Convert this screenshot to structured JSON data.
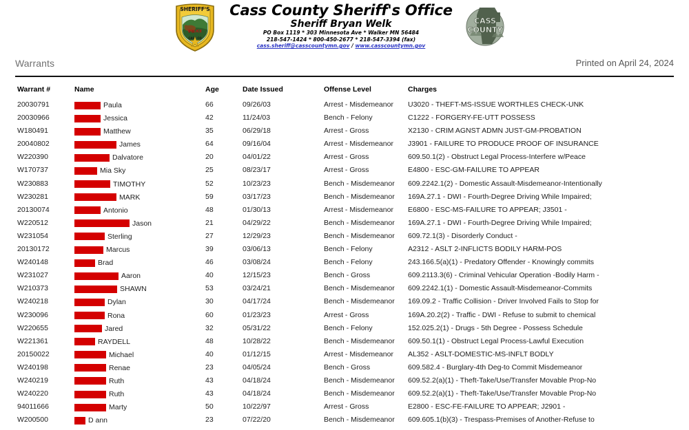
{
  "header": {
    "org_title": "Cass County Sheriff's Office",
    "sheriff_name": "Sheriff Bryan Welk",
    "address_line1": "PO Box 1119 * 303 Minnesota Ave  * Walker MN 56484",
    "address_line2": "218-547-1424 *  800-450-2677 *  218-547-3394 (fax)",
    "email": "cass.sheriff@casscountymn.gov",
    "link_separator": " / ",
    "website": "www.casscountymn.gov",
    "badge_sheriff_alt": "sheriff-badge-logo",
    "badge_sheriff_text": "SHERIFF'S",
    "badge_cass_alt": "cass-county-logo",
    "badge_cass_line1": "CASS",
    "badge_cass_line2": "COUNTY"
  },
  "title_bar": {
    "title": "Warrants",
    "printed_on": "Printed on April 24, 2024"
  },
  "table": {
    "columns": [
      {
        "key": "warrant",
        "label": "Warrant #"
      },
      {
        "key": "name",
        "label": "Name"
      },
      {
        "key": "age",
        "label": "Age"
      },
      {
        "key": "date_issued",
        "label": "Date Issued"
      },
      {
        "key": "offense_level",
        "label": "Offense Level"
      },
      {
        "key": "charges",
        "label": "Charges"
      }
    ],
    "redaction_color": "#d40000",
    "rows": [
      {
        "warrant": "20030791",
        "redact_width": 38,
        "name": "Paula",
        "age": "66",
        "date_issued": "09/26/03",
        "offense_level": "Arrest - Misdemeanor",
        "charges": "U3020 - THEFT-MS-ISSUE WORTHLES CHECK-UNK"
      },
      {
        "warrant": "20030966",
        "redact_width": 38,
        "name": "Jessica",
        "age": "42",
        "date_issued": "11/24/03",
        "offense_level": "Bench - Felony",
        "charges": "C1222 - FORGERY-FE-UTT POSSESS"
      },
      {
        "warrant": "W180491",
        "redact_width": 38,
        "name": "Matthew",
        "age": "35",
        "date_issued": "06/29/18",
        "offense_level": "Arrest - Gross",
        "charges": "X2130 - CRIM AGNST ADMN JUST-GM-PROBATION"
      },
      {
        "warrant": "20040802",
        "redact_width": 61,
        "name": "James",
        "age": "64",
        "date_issued": "09/16/04",
        "offense_level": "Arrest - Misdemeanor",
        "charges": "J3901 - FAILURE TO PRODUCE PROOF OF INSURANCE"
      },
      {
        "warrant": "W220390",
        "redact_width": 51,
        "name": "Dalvatore",
        "age": "20",
        "date_issued": "04/01/22",
        "offense_level": "Arrest - Gross",
        "charges": "609.50.1(2) - Obstruct Legal Process-Interfere w/Peace"
      },
      {
        "warrant": "W170737",
        "redact_width": 33,
        "name": "Mia Sky",
        "age": "25",
        "date_issued": "08/23/17",
        "offense_level": "Arrest - Gross",
        "charges": "E4800 - ESC-GM-FAILURE TO APPEAR"
      },
      {
        "warrant": "W230883",
        "redact_width": 52,
        "name": "TIMOTHY",
        "age": "52",
        "date_issued": "10/23/23",
        "offense_level": "Bench - Misdemeanor",
        "charges": "609.2242.1(2) - Domestic Assault-Misdemeanor-Intentionally"
      },
      {
        "warrant": "W230281",
        "redact_width": 61,
        "name": "MARK",
        "age": "59",
        "date_issued": "03/17/23",
        "offense_level": "Bench - Misdemeanor",
        "charges": "169A.27.1 - DWI - Fourth-Degree Driving While Impaired;"
      },
      {
        "warrant": "20130074",
        "redact_width": 38,
        "name": "Antonio",
        "age": "48",
        "date_issued": "01/30/13",
        "offense_level": "Arrest - Misdemeanor",
        "charges": "E6800 - ESC-MS-FAILURE TO APPEAR; J3501 -"
      },
      {
        "warrant": "W220512",
        "redact_width": 80,
        "name": "Jason",
        "age": "21",
        "date_issued": "04/29/22",
        "offense_level": "Bench - Misdemeanor",
        "charges": "169A.27.1 - DWI - Fourth-Degree Driving While Impaired;"
      },
      {
        "warrant": "W231054",
        "redact_width": 44,
        "name": "Sterling",
        "age": "27",
        "date_issued": "12/29/23",
        "offense_level": "Bench - Misdemeanor",
        "charges": "609.72.1(3) - Disorderly Conduct -"
      },
      {
        "warrant": "20130172",
        "redact_width": 42,
        "name": "Marcus",
        "age": "39",
        "date_issued": "03/06/13",
        "offense_level": "Bench - Felony",
        "charges": "A2312 - ASLT 2-INFLICTS BODILY HARM-POS"
      },
      {
        "warrant": "W240148",
        "redact_width": 30,
        "name": "Brad",
        "age": "46",
        "date_issued": "03/08/24",
        "offense_level": "Bench - Felony",
        "charges": "243.166.5(a)(1) - Predatory Offender - Knowingly commits"
      },
      {
        "warrant": "W231027",
        "redact_width": 64,
        "name": "Aaron",
        "age": "40",
        "date_issued": "12/15/23",
        "offense_level": "Bench - Gross",
        "charges": "609.2113.3(6) - Criminal Vehicular Operation -Bodily Harm -"
      },
      {
        "warrant": "W210373",
        "redact_width": 62,
        "name": "SHAWN",
        "age": "53",
        "date_issued": "03/24/21",
        "offense_level": "Bench - Misdemeanor",
        "charges": "609.2242.1(1) - Domestic Assault-Misdemeanor-Commits"
      },
      {
        "warrant": "W240218",
        "redact_width": 44,
        "name": "Dylan",
        "age": "30",
        "date_issued": "04/17/24",
        "offense_level": "Bench - Misdemeanor",
        "charges": "169.09.2 - Traffic Collision - Driver Involved Fails to Stop for"
      },
      {
        "warrant": "W230096",
        "redact_width": 44,
        "name": "Rona",
        "age": "60",
        "date_issued": "01/23/23",
        "offense_level": "Arrest - Gross",
        "charges": "169A.20.2(2) - Traffic - DWI - Refuse to submit to chemical"
      },
      {
        "warrant": "W220655",
        "redact_width": 40,
        "name": "Jared",
        "age": "32",
        "date_issued": "05/31/22",
        "offense_level": "Bench - Felony",
        "charges": "152.025.2(1) - Drugs - 5th Degree - Possess Schedule"
      },
      {
        "warrant": "W221361",
        "redact_width": 30,
        "name": "RAYDELL",
        "age": "48",
        "date_issued": "10/28/22",
        "offense_level": "Bench - Misdemeanor",
        "charges": "609.50.1(1) - Obstruct Legal Process-Lawful Execution"
      },
      {
        "warrant": "20150022",
        "redact_width": 46,
        "name": "Michael",
        "age": "40",
        "date_issued": "01/12/15",
        "offense_level": "Arrest - Misdemeanor",
        "charges": "AL352 - ASLT-DOMESTIC-MS-INFLT BODLY"
      },
      {
        "warrant": "W240198",
        "redact_width": 46,
        "name": "Renae",
        "age": "23",
        "date_issued": "04/05/24",
        "offense_level": "Bench - Gross",
        "charges": "609.582.4 - Burglary-4th Deg-to Commit Misdemeanor"
      },
      {
        "warrant": "W240219",
        "redact_width": 46,
        "name": "Ruth",
        "age": "43",
        "date_issued": "04/18/24",
        "offense_level": "Bench - Misdemeanor",
        "charges": "609.52.2(a)(1) - Theft-Take/Use/Transfer Movable Prop-No"
      },
      {
        "warrant": "W240220",
        "redact_width": 46,
        "name": "Ruth",
        "age": "43",
        "date_issued": "04/18/24",
        "offense_level": "Bench - Misdemeanor",
        "charges": "609.52.2(a)(1) - Theft-Take/Use/Transfer Movable Prop-No"
      },
      {
        "warrant": "94011666",
        "redact_width": 46,
        "name": "Marty",
        "age": "50",
        "date_issued": "10/22/97",
        "offense_level": "Arrest - Gross",
        "charges": "E2800 - ESC-FE-FAILURE TO APPEAR; J2901 -"
      },
      {
        "warrant": "W200500",
        "redact_width": 16,
        "name": "D ann",
        "age": "23",
        "date_issued": "07/22/20",
        "offense_level": "Bench - Misdemeanor",
        "charges": "609.605.1(b)(3) - Trespass-Premises of Another-Refuse to"
      }
    ]
  }
}
